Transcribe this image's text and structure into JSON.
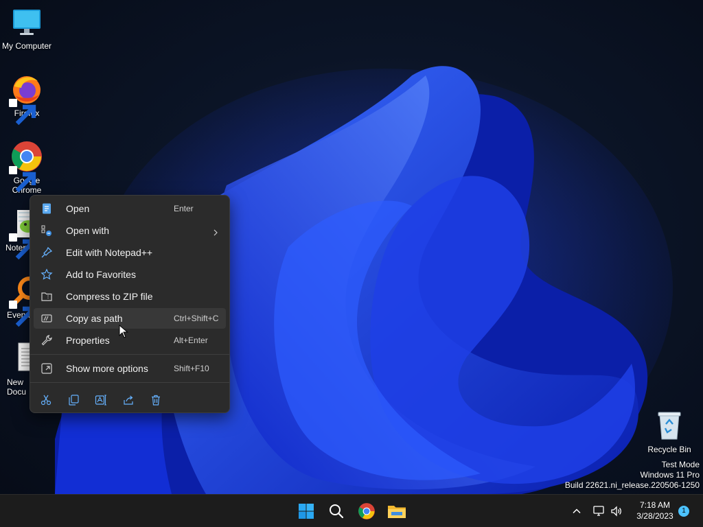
{
  "desktop": {
    "icons": [
      {
        "label": "My Computer",
        "icon": "monitor-icon"
      },
      {
        "label": "Firefox",
        "icon": "firefox-icon"
      },
      {
        "label": "Google Chrome",
        "icon": "chrome-icon"
      },
      {
        "label": "Notep",
        "icon": "notepad-plus-plus-icon"
      },
      {
        "label": "Everyt",
        "icon": "everything-search-icon"
      },
      {
        "label": "New Docu",
        "icon": "text-document-icon"
      }
    ],
    "recycle_bin": {
      "label": "Recycle Bin",
      "icon": "recycle-bin-icon"
    }
  },
  "context_menu": {
    "items": [
      {
        "label": "Open",
        "shortcut": "Enter",
        "icon": "notepad-icon"
      },
      {
        "label": "Open with",
        "shortcut": "",
        "icon": "open-with-icon",
        "submenu": true
      },
      {
        "label": "Edit with Notepad++",
        "shortcut": "",
        "icon": "pin-icon"
      },
      {
        "label": "Add to Favorites",
        "shortcut": "",
        "icon": "star-icon"
      },
      {
        "label": "Compress to ZIP file",
        "shortcut": "",
        "icon": "zip-folder-icon"
      },
      {
        "label": "Copy as path",
        "shortcut": "Ctrl+Shift+C",
        "icon": "copy-path-icon",
        "hovered": true
      },
      {
        "label": "Properties",
        "shortcut": "Alt+Enter",
        "icon": "wrench-icon"
      }
    ],
    "more_options": {
      "label": "Show more options",
      "shortcut": "Shift+F10",
      "icon": "more-options-icon"
    },
    "actions": [
      "cut-icon",
      "copy-icon",
      "rename-icon",
      "share-icon",
      "delete-icon"
    ]
  },
  "watermark": {
    "line1": "Test Mode",
    "line2": "Windows 11 Pro",
    "line3": "Build 22621.ni_release.220506-1250"
  },
  "taskbar": {
    "apps": [
      "windows-start-icon",
      "search-icon",
      "chrome-icon",
      "file-explorer-icon"
    ],
    "tray": [
      "chevron-up-icon",
      "network-icon",
      "volume-icon"
    ],
    "time": "7:18 AM",
    "date": "3/28/2023",
    "notification_count": "1"
  },
  "colors": {
    "menu_bg": "#2b2b2b",
    "menu_hover": "#383838",
    "taskbar_bg": "#1c1c1c",
    "accent": "#4cc2ff"
  }
}
